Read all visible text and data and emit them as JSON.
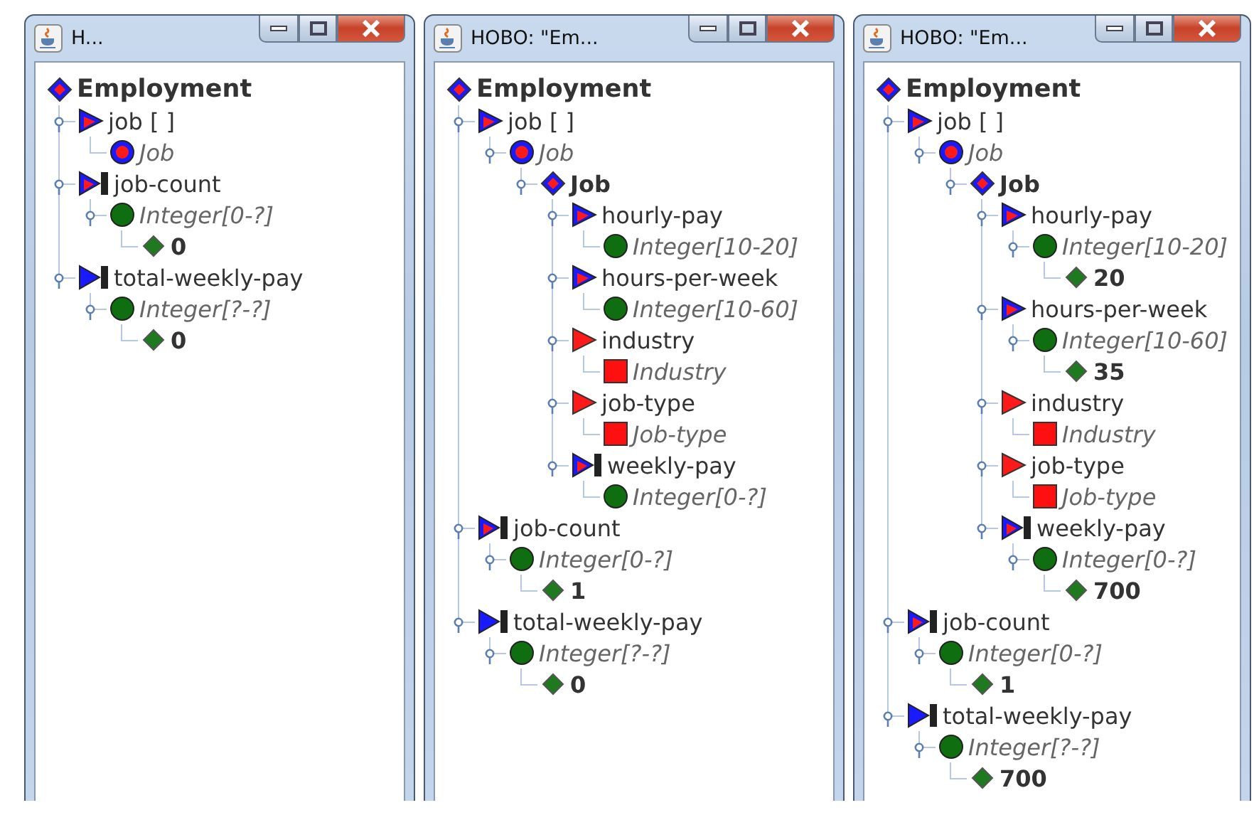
{
  "windows": [
    {
      "title": "H...",
      "tree": {
        "kind": "class",
        "label": "Employment",
        "children": [
          {
            "kind": "slot",
            "label": "job [ ]",
            "children": [
              {
                "kind": "instance",
                "label": "Job"
              }
            ]
          },
          {
            "kind": "slot-single",
            "label": "job-count",
            "children": [
              {
                "kind": "type",
                "label": "Integer[0-?]",
                "children": [
                  {
                    "kind": "value",
                    "label": "0"
                  }
                ]
              }
            ]
          },
          {
            "kind": "slot-total",
            "label": "total-weekly-pay",
            "children": [
              {
                "kind": "type",
                "label": "Integer[?-?]",
                "children": [
                  {
                    "kind": "value",
                    "label": "0"
                  }
                ]
              }
            ]
          }
        ]
      }
    },
    {
      "title": "HOBO: \"Em...",
      "tree": {
        "kind": "class",
        "label": "Employment",
        "children": [
          {
            "kind": "slot",
            "label": "job [ ]",
            "children": [
              {
                "kind": "instance",
                "label": "Job",
                "children": [
                  {
                    "kind": "class",
                    "label": "Job",
                    "children": [
                      {
                        "kind": "slot",
                        "label": "hourly-pay",
                        "children": [
                          {
                            "kind": "type",
                            "label": "Integer[10-20]"
                          }
                        ]
                      },
                      {
                        "kind": "slot",
                        "label": "hours-per-week",
                        "children": [
                          {
                            "kind": "type",
                            "label": "Integer[10-60]"
                          }
                        ]
                      },
                      {
                        "kind": "enum-slot",
                        "label": "industry",
                        "children": [
                          {
                            "kind": "enum-type",
                            "label": "Industry"
                          }
                        ]
                      },
                      {
                        "kind": "enum-slot",
                        "label": "job-type",
                        "children": [
                          {
                            "kind": "enum-type",
                            "label": "Job-type"
                          }
                        ]
                      },
                      {
                        "kind": "slot-single",
                        "label": "weekly-pay",
                        "children": [
                          {
                            "kind": "type",
                            "label": "Integer[0-?]"
                          }
                        ]
                      }
                    ]
                  }
                ]
              }
            ]
          },
          {
            "kind": "slot-single",
            "label": "job-count",
            "children": [
              {
                "kind": "type",
                "label": "Integer[0-?]",
                "children": [
                  {
                    "kind": "value",
                    "label": "1"
                  }
                ]
              }
            ]
          },
          {
            "kind": "slot-total",
            "label": "total-weekly-pay",
            "children": [
              {
                "kind": "type",
                "label": "Integer[?-?]",
                "children": [
                  {
                    "kind": "value",
                    "label": "0"
                  }
                ]
              }
            ]
          }
        ]
      }
    },
    {
      "title": "HOBO: \"Em...",
      "tree": {
        "kind": "class",
        "label": "Employment",
        "children": [
          {
            "kind": "slot",
            "label": "job [ ]",
            "children": [
              {
                "kind": "instance",
                "label": "Job",
                "children": [
                  {
                    "kind": "class",
                    "label": "Job",
                    "children": [
                      {
                        "kind": "slot",
                        "label": "hourly-pay",
                        "children": [
                          {
                            "kind": "type",
                            "label": "Integer[10-20]",
                            "children": [
                              {
                                "kind": "value",
                                "label": "20"
                              }
                            ]
                          }
                        ]
                      },
                      {
                        "kind": "slot",
                        "label": "hours-per-week",
                        "children": [
                          {
                            "kind": "type",
                            "label": "Integer[10-60]",
                            "children": [
                              {
                                "kind": "value",
                                "label": "35"
                              }
                            ]
                          }
                        ]
                      },
                      {
                        "kind": "enum-slot",
                        "label": "industry",
                        "children": [
                          {
                            "kind": "enum-type",
                            "label": "Industry"
                          }
                        ]
                      },
                      {
                        "kind": "enum-slot",
                        "label": "job-type",
                        "children": [
                          {
                            "kind": "enum-type",
                            "label": "Job-type"
                          }
                        ]
                      },
                      {
                        "kind": "slot-single",
                        "label": "weekly-pay",
                        "children": [
                          {
                            "kind": "type",
                            "label": "Integer[0-?]",
                            "children": [
                              {
                                "kind": "value",
                                "label": "700"
                              }
                            ]
                          }
                        ]
                      }
                    ]
                  }
                ]
              }
            ]
          },
          {
            "kind": "slot-single",
            "label": "job-count",
            "children": [
              {
                "kind": "type",
                "label": "Integer[0-?]",
                "children": [
                  {
                    "kind": "value",
                    "label": "1"
                  }
                ]
              }
            ]
          },
          {
            "kind": "slot-total",
            "label": "total-weekly-pay",
            "children": [
              {
                "kind": "type",
                "label": "Integer[?-?]",
                "children": [
                  {
                    "kind": "value",
                    "label": "700"
                  }
                ]
              }
            ]
          }
        ]
      }
    }
  ]
}
